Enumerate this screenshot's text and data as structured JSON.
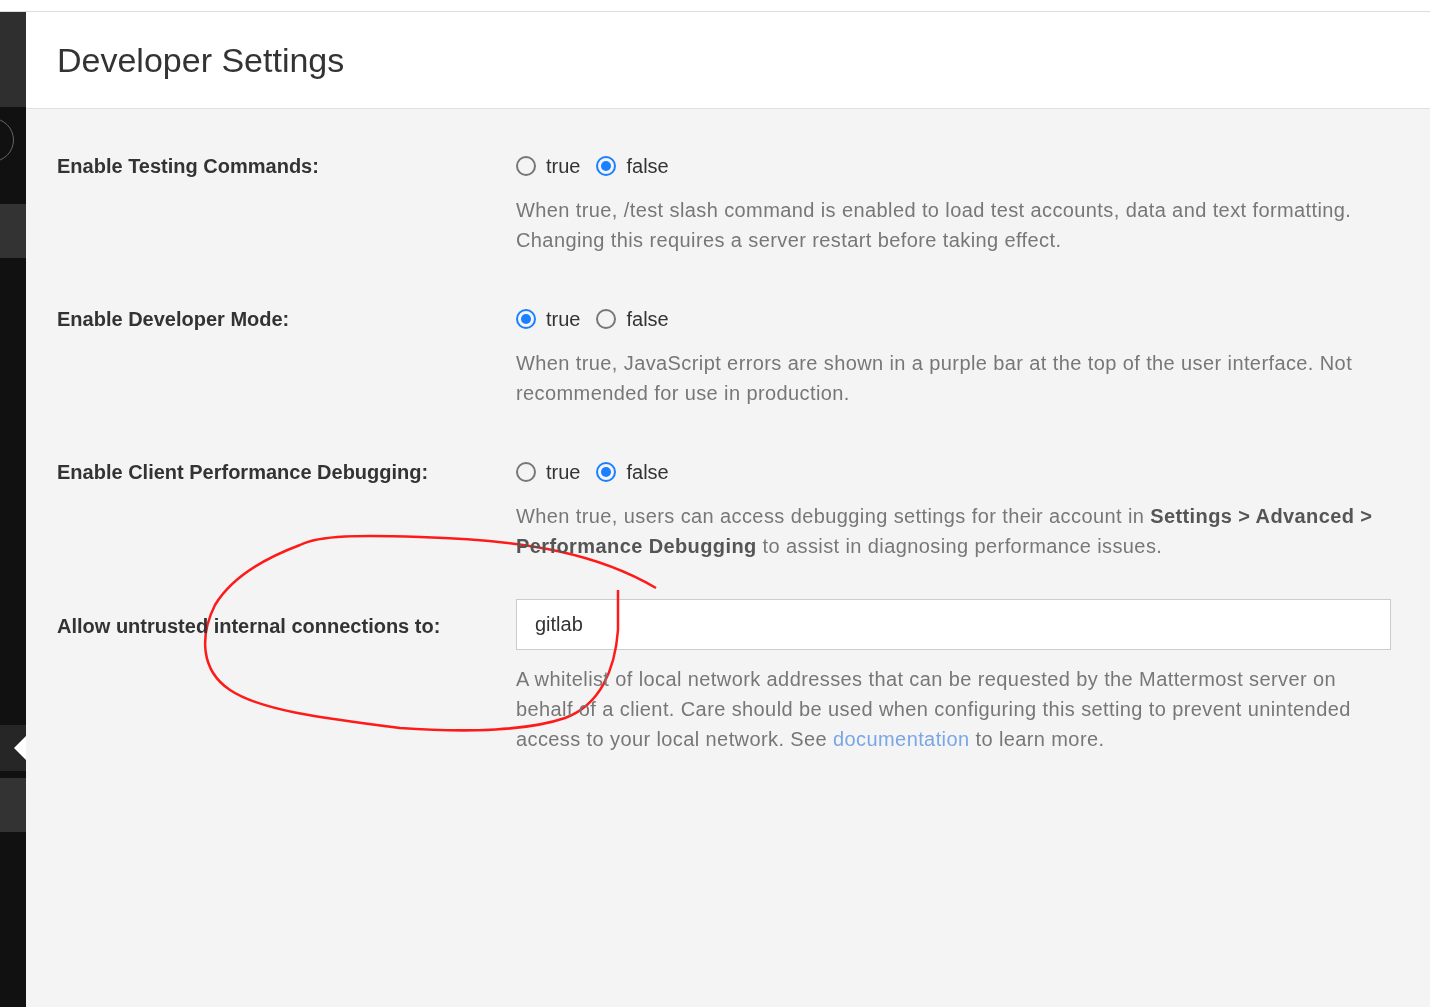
{
  "header": {
    "title": "Developer Settings"
  },
  "settings": [
    {
      "kind": "radio",
      "label": "Enable Testing Commands:",
      "options": [
        {
          "label": "true",
          "selected": false
        },
        {
          "label": "false",
          "selected": true
        }
      ],
      "help": [
        {
          "kind": "text",
          "text": "When true, /test slash command is enabled to load test accounts, data and text formatting. Changing this requires a server restart before taking effect."
        }
      ]
    },
    {
      "kind": "radio",
      "label": "Enable Developer Mode:",
      "options": [
        {
          "label": "true",
          "selected": true
        },
        {
          "label": "false",
          "selected": false
        }
      ],
      "help": [
        {
          "kind": "text",
          "text": "When true, JavaScript errors are shown in a purple bar at the top of the user interface. Not recommended for use in production."
        }
      ]
    },
    {
      "kind": "radio",
      "label": "Enable Client Performance Debugging:",
      "options": [
        {
          "label": "true",
          "selected": false
        },
        {
          "label": "false",
          "selected": true
        }
      ],
      "help": [
        {
          "kind": "text",
          "text": "When true, users can access debugging settings for their account in **Settings > Advanced > Performance Debugging** to assist in diagnosing performance issues."
        }
      ]
    },
    {
      "kind": "text",
      "label": "Allow untrusted internal connections to:",
      "value": "gitlab",
      "help": [
        {
          "kind": "text",
          "text": "A whitelist of local network addresses that can be requested by the Mattermost server on behalf of a client. Care should be used when configuring this setting to prevent unintended access to your local network. See "
        },
        {
          "kind": "link",
          "text": "documentation"
        },
        {
          "kind": "text",
          "text": " to learn more."
        }
      ]
    }
  ]
}
